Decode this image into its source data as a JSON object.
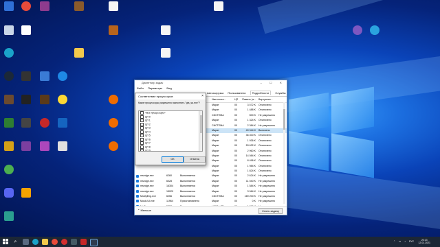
{
  "desktop": {
    "icons": [
      {
        "label": "",
        "color": "#2f6fd6"
      },
      {
        "label": "",
        "color": "#d6d6d6"
      },
      {
        "label": "",
        "color": "#e8b13a"
      },
      {
        "label": "",
        "color": "#4caf50"
      },
      {
        "label": "",
        "color": "#e84b3a"
      },
      {
        "label": "",
        "color": "#8a5a2b"
      },
      {
        "label": "",
        "color": "#ffffff"
      },
      {
        "label": "",
        "color": "#ffffff"
      }
    ]
  },
  "task_manager": {
    "title": "Диспетчер задач",
    "menu": [
      "Файл",
      "Параметры",
      "Вид"
    ],
    "tabs": [
      "Автозагрузка",
      "Пользователи",
      "Подробности",
      "Службы"
    ],
    "active_tab": "Подробности",
    "columns": {
      "name": "Имя",
      "status": "Сост.",
      "user": "Имя польз...",
      "cpu": "ЦП",
      "mem": "Память (а...",
      "virt": "Виртуализ..."
    },
    "rows": [
      {
        "name": "",
        "pid": "",
        "status": "",
        "user": "Марат",
        "cpu": "00",
        "mem": "3 572 K",
        "virt": "Отключено"
      },
      {
        "name": "",
        "pid": "",
        "status": "",
        "user": "Марат",
        "cpu": "00",
        "mem": "1 488 K",
        "virt": "Отключено"
      },
      {
        "name": "",
        "pid": "",
        "status": "",
        "user": "СИСТЕМА",
        "cpu": "00",
        "mem": "500 K",
        "virt": "Не разрешено"
      },
      {
        "name": "",
        "pid": "",
        "status": "",
        "user": "Марат",
        "cpu": "00",
        "mem": "1 324 K",
        "virt": "Отключено"
      },
      {
        "name": "",
        "pid": "",
        "status": "",
        "user": "СИСТЕМА",
        "cpu": "00",
        "mem": "2 384 K",
        "virt": "Не разрешено"
      },
      {
        "name": "",
        "pid": "",
        "status": "",
        "user": "Марат",
        "cpu": "00",
        "mem": "49 944 K",
        "virt": "Включено",
        "selected": true
      },
      {
        "name": "",
        "pid": "",
        "status": "",
        "user": "Марат",
        "cpu": "00",
        "mem": "36 400 K",
        "virt": "Отключено"
      },
      {
        "name": "",
        "pid": "",
        "status": "",
        "user": "Марат",
        "cpu": "00",
        "mem": "1 936 K",
        "virt": "Отключено"
      },
      {
        "name": "",
        "pid": "",
        "status": "",
        "user": "Марат",
        "cpu": "00",
        "mem": "53 632 K",
        "virt": "Отключено"
      },
      {
        "name": "",
        "pid": "",
        "status": "",
        "user": "Марат",
        "cpu": "00",
        "mem": "2 960 K",
        "virt": "Отключено"
      },
      {
        "name": "",
        "pid": "",
        "status": "",
        "user": "Марат",
        "cpu": "00",
        "mem": "14 084 K",
        "virt": "Отключено"
      },
      {
        "name": "",
        "pid": "",
        "status": "",
        "user": "Марат",
        "cpu": "00",
        "mem": "8 496 K",
        "virt": "Отключено"
      },
      {
        "name": "",
        "pid": "",
        "status": "",
        "user": "Марат",
        "cpu": "00",
        "mem": "1 984 K",
        "virt": "Отключено"
      },
      {
        "name": "",
        "pid": "",
        "status": "",
        "user": "Марат",
        "cpu": "00",
        "mem": "1 824 K",
        "virt": "Отключено"
      },
      {
        "name": "msedge.exe",
        "pid": "6260",
        "status": "Выполняется",
        "user": "Марат",
        "cpu": "00",
        "mem": "2 624 K",
        "virt": "Не разрешено"
      },
      {
        "name": "msedge.exe",
        "pid": "6028",
        "status": "Выполняется",
        "user": "Марат",
        "cpu": "00",
        "mem": "11 040 K",
        "virt": "Не разрешено"
      },
      {
        "name": "msedge.exe",
        "pid": "16304",
        "status": "Выполняется",
        "user": "Марат",
        "cpu": "00",
        "mem": "1 584 K",
        "virt": "Не разрешено"
      },
      {
        "name": "msedge.exe",
        "pid": "15020",
        "status": "Выполняется",
        "user": "Марат",
        "cpu": "00",
        "mem": "3 064 K",
        "virt": "Не разрешено"
      },
      {
        "name": "MsMpEng.exe",
        "pid": "6256",
        "status": "Выполняется",
        "user": "СИСТЕМА",
        "cpu": "00",
        "mem": "169 200 K",
        "virt": "Не разрешено"
      },
      {
        "name": "Music.UI.exe",
        "pid": "11964",
        "status": "Приостановлено",
        "user": "Марат",
        "cpu": "00",
        "mem": "0 K",
        "virt": "Не разрешено"
      },
      {
        "name": "NisSrv.exe",
        "pid": "5228",
        "status": "Выполняется",
        "user": "LOCAL SE...",
        "cpu": "00",
        "mem": "1 896 K",
        "virt": "Не разрешено"
      },
      {
        "name": "NVIDIA Web Helpe...",
        "pid": "5096",
        "status": "Выполняется",
        "user": "Марат",
        "cpu": "00",
        "mem": "1 044 K",
        "virt": "Не разрешено"
      }
    ],
    "less_label": "Меньше",
    "end_task_label": "Снять задачу"
  },
  "affinity_dialog": {
    "title": "Соответствие процессоров",
    "question": "Какие процессоры разрешено выполнять \"gta_sa.exe\"?",
    "items": [
      "<Все процессоры>",
      "ЦП 0",
      "ЦП 1",
      "ЦП 2",
      "ЦП 3",
      "ЦП 4",
      "ЦП 5",
      "ЦП 6",
      "ЦП 7",
      "ЦП 8",
      "ЦП 9"
    ],
    "ok_label": "ОК",
    "cancel_label": "Отмена"
  },
  "taskbar": {
    "time": "20:13",
    "date": "12.01.2021",
    "lang": "РУС",
    "tray": "⌃ ▭ ♪"
  }
}
